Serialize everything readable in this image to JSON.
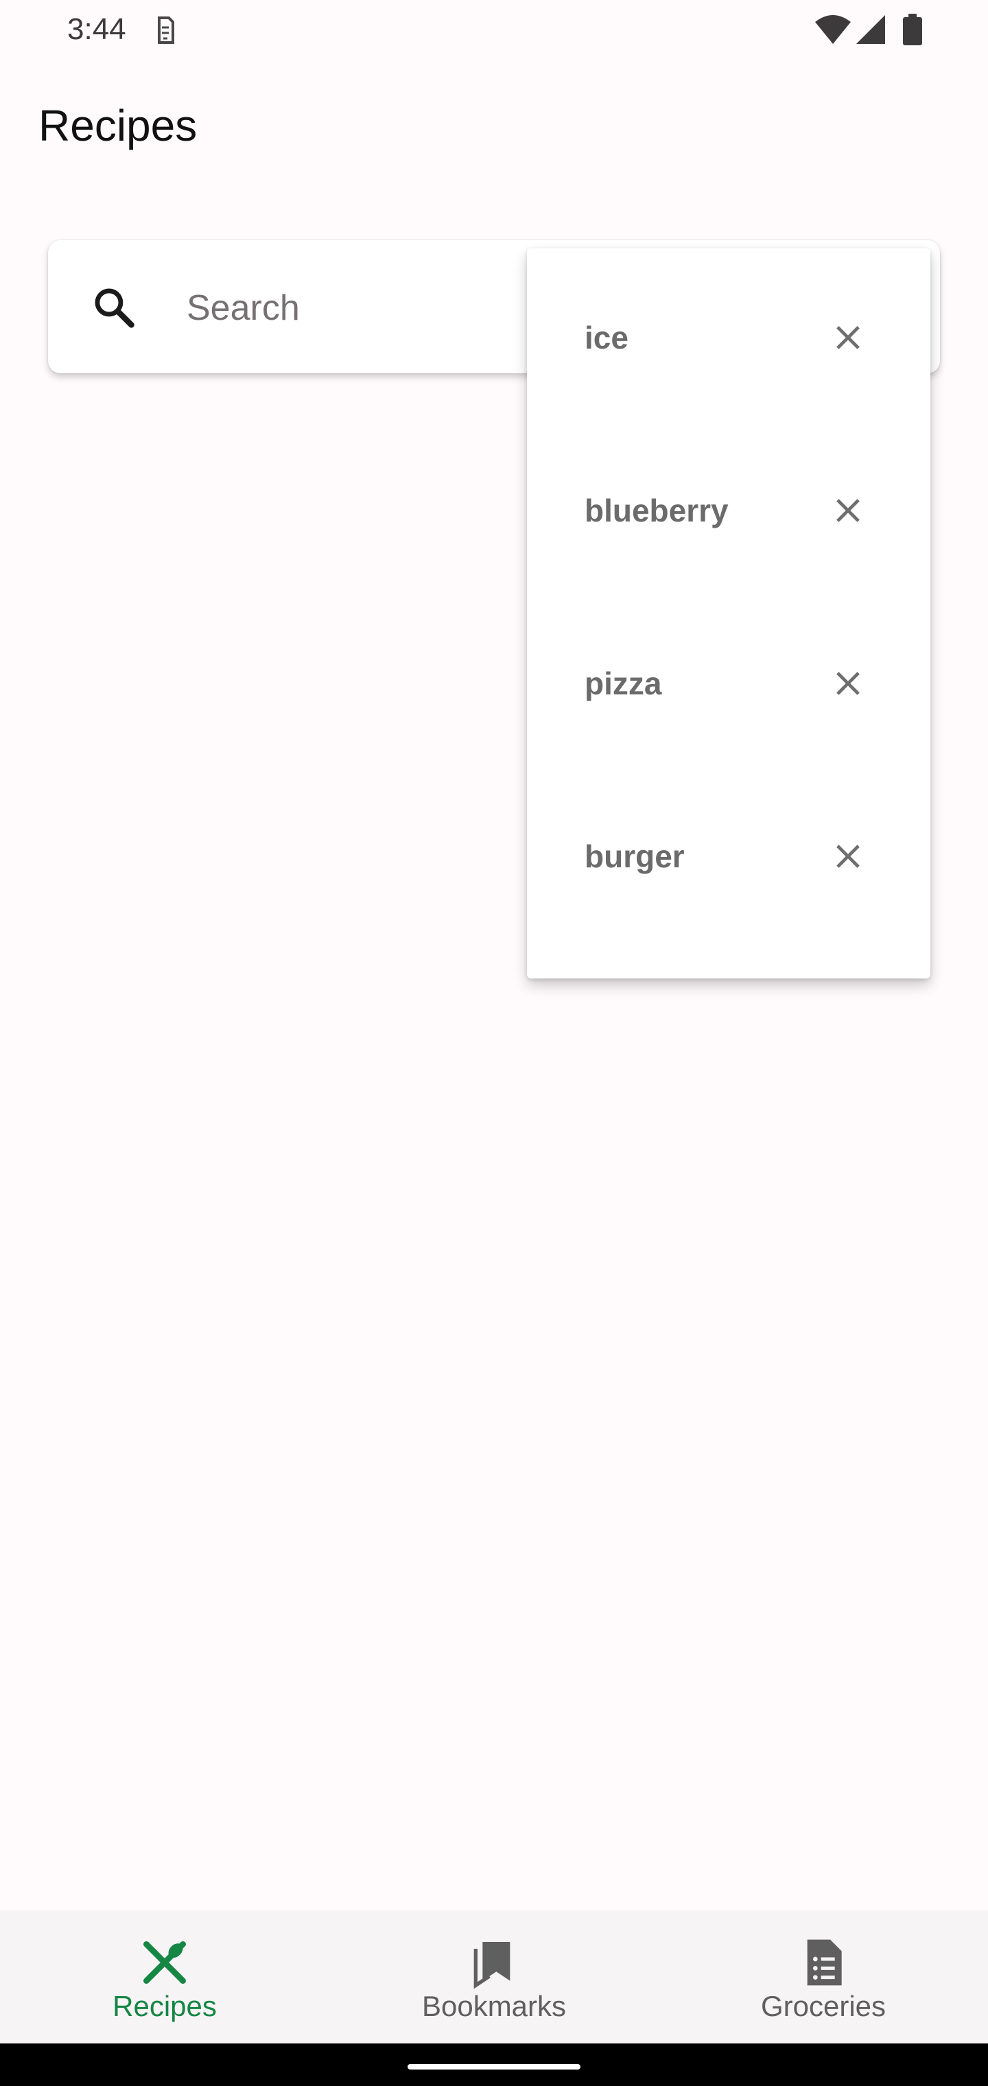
{
  "status_bar": {
    "time": "3:44",
    "icons": [
      "sim-card-icon",
      "wifi-icon",
      "signal-icon",
      "battery-icon"
    ]
  },
  "page": {
    "title": "Recipes"
  },
  "search": {
    "placeholder": "Search",
    "value": ""
  },
  "suggestions": [
    {
      "label": "ice",
      "remove_icon": "close-icon"
    },
    {
      "label": "blueberry",
      "remove_icon": "close-icon"
    },
    {
      "label": "pizza",
      "remove_icon": "close-icon"
    },
    {
      "label": "burger",
      "remove_icon": "close-icon"
    }
  ],
  "bottom_nav": {
    "items": [
      {
        "label": "Recipes",
        "icon": "restaurant-icon",
        "active": true
      },
      {
        "label": "Bookmarks",
        "icon": "bookmarks-icon",
        "active": false
      },
      {
        "label": "Groceries",
        "icon": "groceries-list-icon",
        "active": false
      }
    ]
  },
  "colors": {
    "accent": "#168645",
    "inactive_nav": "#5f5f5f",
    "suggestion_text": "#6b6b6b",
    "background": "#fffbfd"
  }
}
